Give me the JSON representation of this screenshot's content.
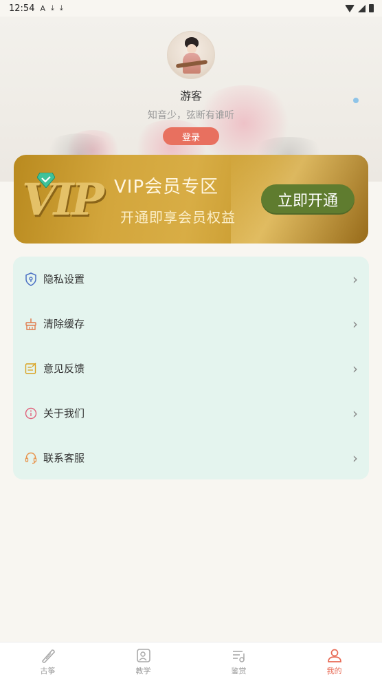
{
  "status_bar": {
    "time": "12:54",
    "left_icons": [
      "A",
      "⤓",
      "⤓"
    ],
    "right_icons": [
      "wifi-icon",
      "signal-icon",
      "battery-icon"
    ]
  },
  "profile": {
    "name": "游客",
    "motto": "知音少，弦断有谁听",
    "login_label": "登录"
  },
  "vip_banner": {
    "logo_text": "VIP",
    "title": "VIP会员专区",
    "subtitle": "开通即享会员权益",
    "button_label": "立即开通"
  },
  "menu": {
    "items": [
      {
        "label": "隐私设置",
        "icon": "shield-icon",
        "color": "#4a6fc4"
      },
      {
        "label": "清除缓存",
        "icon": "broom-icon",
        "color": "#e07a4a"
      },
      {
        "label": "意见反馈",
        "icon": "feedback-icon",
        "color": "#d9a21f"
      },
      {
        "label": "关于我们",
        "icon": "info-icon",
        "color": "#e0607a"
      },
      {
        "label": "联系客服",
        "icon": "headset-icon",
        "color": "#e8924a"
      }
    ],
    "chevron": "›"
  },
  "bottom_nav": {
    "items": [
      {
        "label": "古筝",
        "icon": "guzheng-icon",
        "active": false
      },
      {
        "label": "教学",
        "icon": "teaching-icon",
        "active": false
      },
      {
        "label": "鉴赏",
        "icon": "music-list-icon",
        "active": false
      },
      {
        "label": "我的",
        "icon": "user-icon",
        "active": true
      }
    ]
  },
  "colors": {
    "accent": "#e8705f",
    "menu_bg": "#e4f4ee",
    "vip_button": "#5f7c2f",
    "active_nav": "#e86a55"
  }
}
